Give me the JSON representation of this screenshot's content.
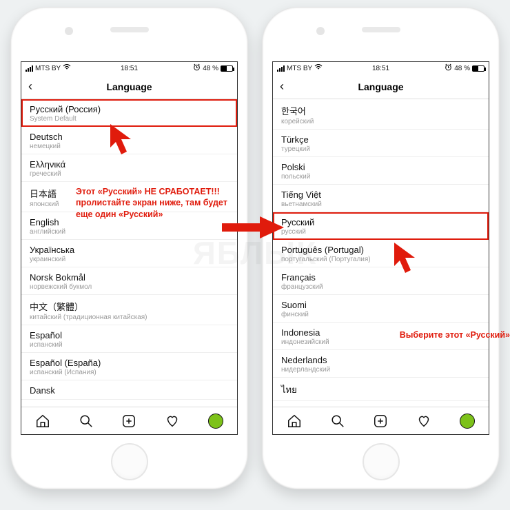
{
  "statusbar": {
    "carrier": "MTS BY",
    "time": "18:51",
    "alarm_icon": "alarm-icon",
    "battery_pct": "48 %"
  },
  "header": {
    "title": "Language"
  },
  "phone1": {
    "rows": [
      {
        "title": "Русский (Россия)",
        "sub": "System Default",
        "highlighted": true
      },
      {
        "title": "Deutsch",
        "sub": "немецкий"
      },
      {
        "title": "Ελληνικά",
        "sub": "греческий"
      },
      {
        "title": "日本語",
        "sub": "японский"
      },
      {
        "title": "English",
        "sub": "английский"
      },
      {
        "title": "Українська",
        "sub": "украинский"
      },
      {
        "title": "Norsk Bokmål",
        "sub": "норвежский букмол"
      },
      {
        "title": "中文（繁體）",
        "sub": "китайский (традиционная китайская)"
      },
      {
        "title": "Español",
        "sub": "испанский"
      },
      {
        "title": "Español (España)",
        "sub": "испанский (Испания)"
      },
      {
        "title": "Dansk",
        "sub": ""
      }
    ]
  },
  "phone2": {
    "rows": [
      {
        "title": "한국어",
        "sub": "корейский"
      },
      {
        "title": "Türkçe",
        "sub": "турецкий"
      },
      {
        "title": "Polski",
        "sub": "польский"
      },
      {
        "title": "Tiếng Việt",
        "sub": "вьетнамский"
      },
      {
        "title": "Русский",
        "sub": "русский",
        "highlighted": true
      },
      {
        "title": "Português (Portugal)",
        "sub": "португальский (Португалия)"
      },
      {
        "title": "Français",
        "sub": "французский"
      },
      {
        "title": "Suomi",
        "sub": "финский"
      },
      {
        "title": "Indonesia",
        "sub": "индонезийский"
      },
      {
        "title": "Nederlands",
        "sub": "нидерландский"
      },
      {
        "title": "ไทย",
        "sub": ""
      }
    ]
  },
  "annotations": {
    "left_note_line1": "Этот «Русский» НЕ СРАБОТАЕТ!!!",
    "left_note_line2": "пролистайте экран ниже, там будет",
    "left_note_line3": "еще один «Русский»",
    "right_note": "Выберите этот «Русский»"
  },
  "watermark": "ЯБЛЫК",
  "tabbar": {
    "icons": [
      "home-icon",
      "search-icon",
      "add-icon",
      "heart-icon",
      "profile-avatar"
    ]
  }
}
